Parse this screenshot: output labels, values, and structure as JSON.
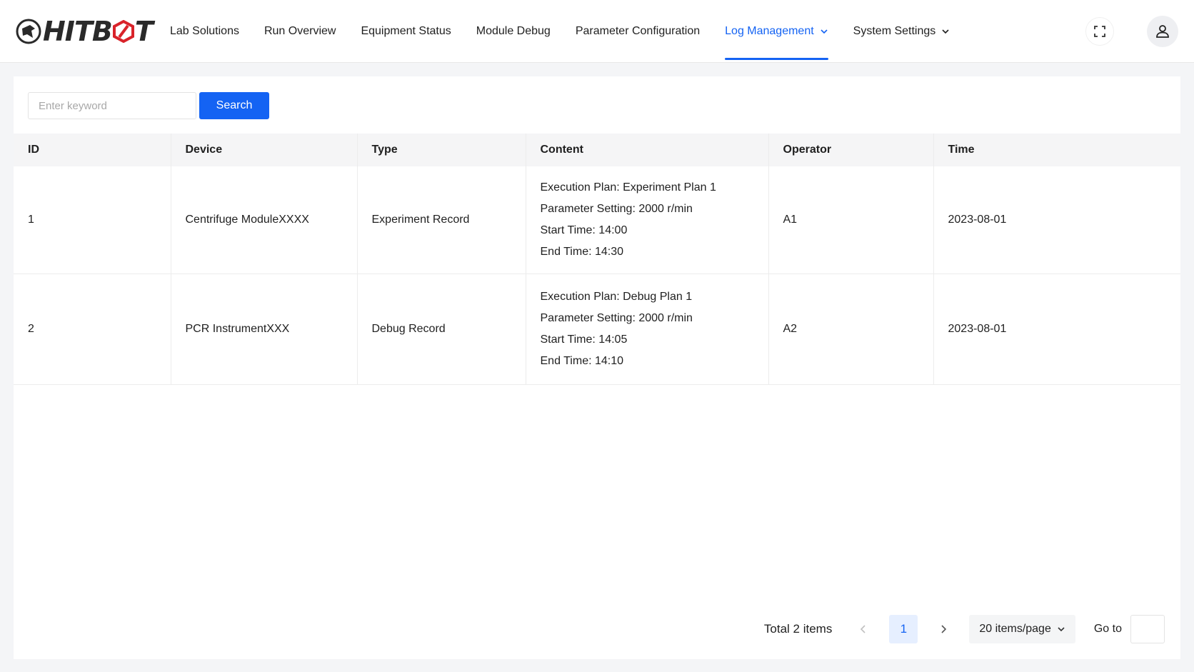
{
  "header": {
    "logo_text_left": "HITB",
    "logo_text_accent": "O",
    "logo_text_right": "T",
    "nav": [
      {
        "label": "Lab Solutions"
      },
      {
        "label": "Run Overview"
      },
      {
        "label": "Equipment Status"
      },
      {
        "label": "Module Debug"
      },
      {
        "label": "Parameter Configuration"
      },
      {
        "label": "Log Management"
      },
      {
        "label": "System Settings"
      }
    ],
    "active_nav": "Log Management",
    "accent_color": "#1463f3",
    "icons": {
      "fullscreen": "fullscreen-icon",
      "user": "user-icon"
    }
  },
  "search": {
    "placeholder": "Enter keyword",
    "value": "",
    "button_label": "Search"
  },
  "table": {
    "columns": [
      "ID",
      "Device",
      "Type",
      "Content",
      "Operator",
      "Time"
    ],
    "rows": [
      {
        "id": "1",
        "device": "Centrifuge ModuleXXXX",
        "type": "Experiment Record",
        "content": [
          "Execution Plan: Experiment Plan 1",
          "Parameter Setting: 2000 r/min",
          "Start Time: 14:00",
          "End Time: 14:30"
        ],
        "operator": "A1",
        "time": "2023-08-01"
      },
      {
        "id": "2",
        "device": "PCR InstrumentXXX",
        "type": "Debug Record",
        "content": [
          "Execution Plan: Debug Plan 1",
          "Parameter Setting: 2000 r/min",
          "Start Time: 14:05",
          "End Time: 14:10"
        ],
        "operator": "A2",
        "time": "2023-08-01"
      }
    ]
  },
  "pagination": {
    "total_label": "Total 2 items",
    "current_page": "1",
    "page_size": "20 items/page",
    "goto_label": "Go to",
    "goto_value": ""
  }
}
